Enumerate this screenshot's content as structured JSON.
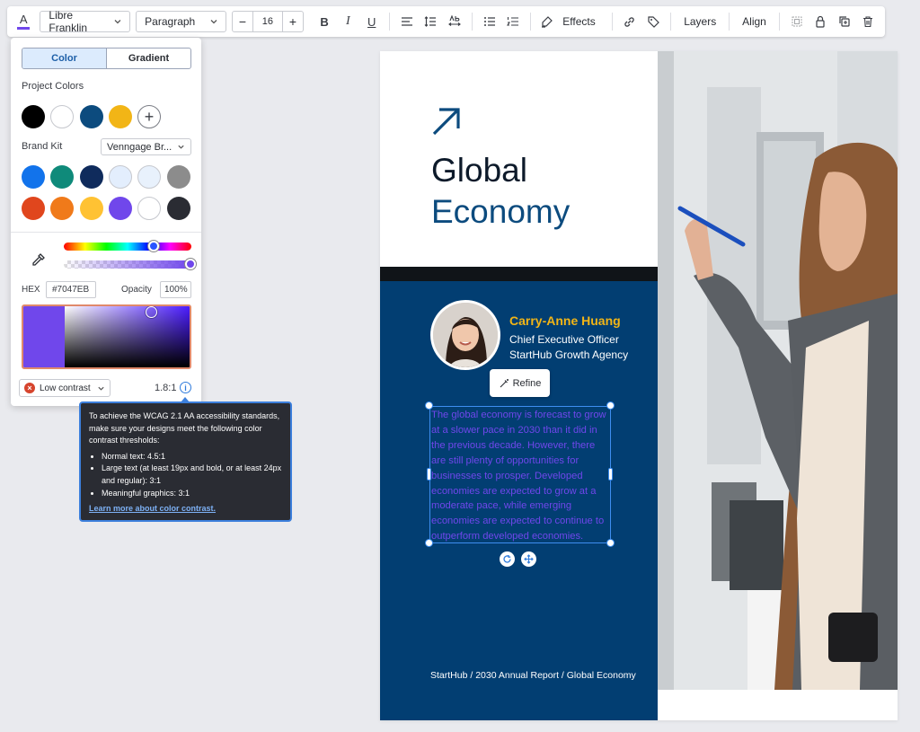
{
  "toolbar": {
    "font_family": "Libre Franklin",
    "text_style": "Paragraph",
    "font_size": "16",
    "decrease": "−",
    "increase": "+",
    "bold": "B",
    "italic": "I",
    "underline": "U",
    "effects": "Effects",
    "layers": "Layers",
    "align": "Align",
    "text_color_hex": "#7047EB"
  },
  "color_panel": {
    "tabs": [
      "Color",
      "Gradient"
    ],
    "active_tab": "Color",
    "project_colors_label": "Project Colors",
    "project_colors": [
      "#000000",
      "#ffffff",
      "#0c4b7e",
      "#f2b516"
    ],
    "add_color": "+",
    "brand_kit_label": "Brand Kit",
    "brand_kit_value": "Venngage Br...",
    "brand_colors": [
      "#1273eb",
      "#0f8a7a",
      "#0f2b5c",
      "#e3eefd",
      "#e8f1fc",
      "#8c8c8c",
      "#e0461d",
      "#f07a1a",
      "#ffc233",
      "#7047eb",
      "#ffffff",
      "#2a2c33"
    ],
    "hex_label": "HEX",
    "hex_value": "#7047EB",
    "opacity_label": "Opacity",
    "opacity_value": "100",
    "opacity_unit": "%",
    "contrast_status": "Low contrast",
    "contrast_ratio": "1.8:1",
    "info": "i"
  },
  "tooltip": {
    "intro": "To achieve the WCAG 2.1 AA accessibility standards, make sure your designs meet the following color contrast thresholds:",
    "items": [
      "Normal text: 4.5:1",
      "Large text (at least 19px and bold, or at least 24px and regular): 3:1",
      "Meaningful graphics: 3:1"
    ],
    "link": "Learn more about color contrast."
  },
  "page": {
    "title_line1": "Global",
    "title_line2": "Economy",
    "person_name": "Carry-Anne Huang",
    "person_role": "Chief Executive Officer",
    "person_org": "StartHub Growth Agency",
    "refine": "Refine",
    "body": "The global economy is forecast to grow at a slower pace in 2030 than it did in the previous decade. However, there are still plenty of opportunities for businesses to prosper. Developed economies are expected to grow at a moderate pace, while emerging economies are expected to continue to outperform developed economies.",
    "footer": "StartHub / 2030 Annual Report / Global Economy"
  }
}
